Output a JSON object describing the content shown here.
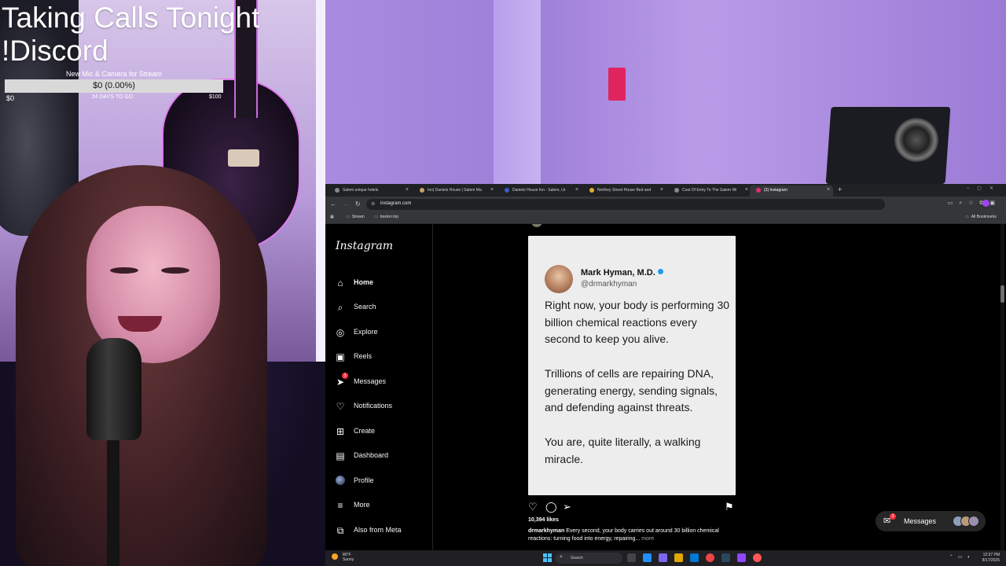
{
  "stream_overlay": {
    "title": "Taking Calls Tonight !Discord",
    "goal": {
      "name": "New Mic & Camera for Stream",
      "progress_label": "$0 (0.00%)",
      "progress_fraction": 0.0,
      "min_label": "$0",
      "days_left": "24 DAYS TO GO",
      "max_label": "$100"
    }
  },
  "browser": {
    "tabs": [
      {
        "label": "Salem unique hotels",
        "active": false
      },
      {
        "label": "Inn| Daniels House | Salem Ma",
        "active": false
      },
      {
        "label": "Daniels House Inn - Salem, Ur",
        "active": false
      },
      {
        "label": "Northey Street House Bed and",
        "active": false
      },
      {
        "label": "Cost Of Entry To The Salem Wi",
        "active": false
      },
      {
        "label": "(3) Instagram",
        "active": true
      }
    ],
    "url": "instagram.com",
    "bookmarks": [
      {
        "label": "Stream"
      },
      {
        "label": "boston trip"
      }
    ],
    "all_bookmarks_label": "All Bookmarks"
  },
  "instagram": {
    "logo": "Instagram",
    "nav": [
      {
        "key": "home",
        "label": "Home",
        "icon": "home-icon",
        "glyph": "⌂",
        "bold": true
      },
      {
        "key": "search",
        "label": "Search",
        "icon": "search-icon",
        "glyph": "⌕"
      },
      {
        "key": "explore",
        "label": "Explore",
        "icon": "compass-icon",
        "glyph": "◎"
      },
      {
        "key": "reels",
        "label": "Reels",
        "icon": "reels-icon",
        "glyph": "▣"
      },
      {
        "key": "messages",
        "label": "Messages",
        "icon": "send-icon",
        "glyph": "➤",
        "badge": "3"
      },
      {
        "key": "notifications",
        "label": "Notifications",
        "icon": "heart-icon",
        "glyph": "♡"
      },
      {
        "key": "create",
        "label": "Create",
        "icon": "plus-square-icon",
        "glyph": "⊞"
      },
      {
        "key": "dashboard",
        "label": "Dashboard",
        "icon": "chart-icon",
        "glyph": "▤"
      },
      {
        "key": "profile",
        "label": "Profile",
        "icon": "avatar-icon",
        "glyph": ""
      },
      {
        "key": "more",
        "label": "More",
        "icon": "menu-icon",
        "glyph": "≡"
      },
      {
        "key": "meta",
        "label": "Also from Meta",
        "icon": "meta-icon",
        "glyph": "⧉"
      }
    ],
    "post": {
      "author_name": "Mark Hyman, M.D.",
      "author_handle": "@drmarkhyman",
      "paragraphs": [
        "Right now, your body is performing 30 billion chemical reactions every second to keep you alive.",
        "Trillions of cells are repairing DNA, generating energy, sending signals, and defending against threats.",
        "You are, quite literally, a walking miracle."
      ],
      "likes": "10,394 likes",
      "caption_user": "drmarkhyman",
      "caption_text": " Every second, your body carries out around 30 billion chemical reactions: turning food into energy, repairing...",
      "caption_more": " more"
    },
    "messages_pill": {
      "label": "Messages",
      "badge": "3"
    }
  },
  "taskbar": {
    "weather_temp": "80°F",
    "weather_desc": "Sunny",
    "search_label": "Search",
    "time": "12:37 PM",
    "date": "8/17/2025"
  },
  "colors": {
    "ig_background": "#000000",
    "accent_verified": "#1d9bf0",
    "badge_red": "#ff3040",
    "goal_bar": "#d9d9d9"
  }
}
